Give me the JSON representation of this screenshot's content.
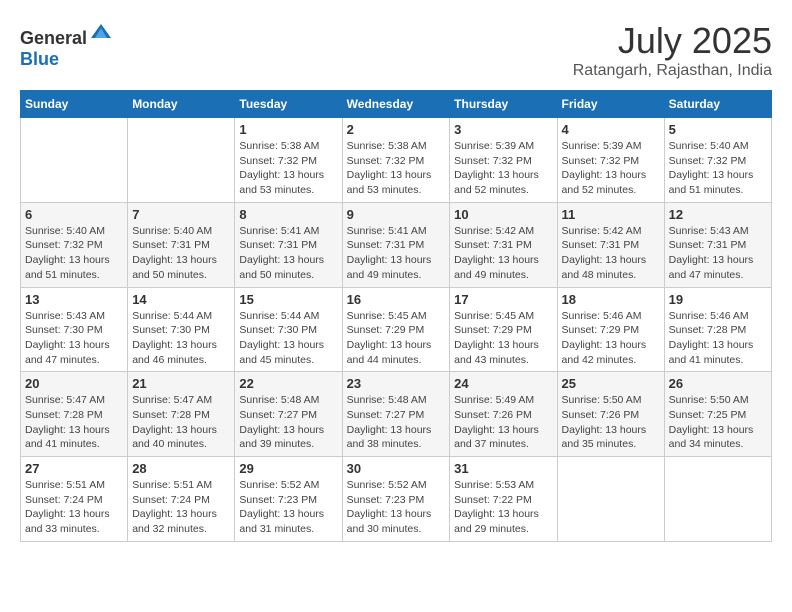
{
  "header": {
    "logo_general": "General",
    "logo_blue": "Blue",
    "month": "July 2025",
    "location": "Ratangarh, Rajasthan, India"
  },
  "weekdays": [
    "Sunday",
    "Monday",
    "Tuesday",
    "Wednesday",
    "Thursday",
    "Friday",
    "Saturday"
  ],
  "weeks": [
    [
      {
        "day": "",
        "sunrise": "",
        "sunset": "",
        "daylight": ""
      },
      {
        "day": "",
        "sunrise": "",
        "sunset": "",
        "daylight": ""
      },
      {
        "day": "1",
        "sunrise": "Sunrise: 5:38 AM",
        "sunset": "Sunset: 7:32 PM",
        "daylight": "Daylight: 13 hours and 53 minutes."
      },
      {
        "day": "2",
        "sunrise": "Sunrise: 5:38 AM",
        "sunset": "Sunset: 7:32 PM",
        "daylight": "Daylight: 13 hours and 53 minutes."
      },
      {
        "day": "3",
        "sunrise": "Sunrise: 5:39 AM",
        "sunset": "Sunset: 7:32 PM",
        "daylight": "Daylight: 13 hours and 52 minutes."
      },
      {
        "day": "4",
        "sunrise": "Sunrise: 5:39 AM",
        "sunset": "Sunset: 7:32 PM",
        "daylight": "Daylight: 13 hours and 52 minutes."
      },
      {
        "day": "5",
        "sunrise": "Sunrise: 5:40 AM",
        "sunset": "Sunset: 7:32 PM",
        "daylight": "Daylight: 13 hours and 51 minutes."
      }
    ],
    [
      {
        "day": "6",
        "sunrise": "Sunrise: 5:40 AM",
        "sunset": "Sunset: 7:32 PM",
        "daylight": "Daylight: 13 hours and 51 minutes."
      },
      {
        "day": "7",
        "sunrise": "Sunrise: 5:40 AM",
        "sunset": "Sunset: 7:31 PM",
        "daylight": "Daylight: 13 hours and 50 minutes."
      },
      {
        "day": "8",
        "sunrise": "Sunrise: 5:41 AM",
        "sunset": "Sunset: 7:31 PM",
        "daylight": "Daylight: 13 hours and 50 minutes."
      },
      {
        "day": "9",
        "sunrise": "Sunrise: 5:41 AM",
        "sunset": "Sunset: 7:31 PM",
        "daylight": "Daylight: 13 hours and 49 minutes."
      },
      {
        "day": "10",
        "sunrise": "Sunrise: 5:42 AM",
        "sunset": "Sunset: 7:31 PM",
        "daylight": "Daylight: 13 hours and 49 minutes."
      },
      {
        "day": "11",
        "sunrise": "Sunrise: 5:42 AM",
        "sunset": "Sunset: 7:31 PM",
        "daylight": "Daylight: 13 hours and 48 minutes."
      },
      {
        "day": "12",
        "sunrise": "Sunrise: 5:43 AM",
        "sunset": "Sunset: 7:31 PM",
        "daylight": "Daylight: 13 hours and 47 minutes."
      }
    ],
    [
      {
        "day": "13",
        "sunrise": "Sunrise: 5:43 AM",
        "sunset": "Sunset: 7:30 PM",
        "daylight": "Daylight: 13 hours and 47 minutes."
      },
      {
        "day": "14",
        "sunrise": "Sunrise: 5:44 AM",
        "sunset": "Sunset: 7:30 PM",
        "daylight": "Daylight: 13 hours and 46 minutes."
      },
      {
        "day": "15",
        "sunrise": "Sunrise: 5:44 AM",
        "sunset": "Sunset: 7:30 PM",
        "daylight": "Daylight: 13 hours and 45 minutes."
      },
      {
        "day": "16",
        "sunrise": "Sunrise: 5:45 AM",
        "sunset": "Sunset: 7:29 PM",
        "daylight": "Daylight: 13 hours and 44 minutes."
      },
      {
        "day": "17",
        "sunrise": "Sunrise: 5:45 AM",
        "sunset": "Sunset: 7:29 PM",
        "daylight": "Daylight: 13 hours and 43 minutes."
      },
      {
        "day": "18",
        "sunrise": "Sunrise: 5:46 AM",
        "sunset": "Sunset: 7:29 PM",
        "daylight": "Daylight: 13 hours and 42 minutes."
      },
      {
        "day": "19",
        "sunrise": "Sunrise: 5:46 AM",
        "sunset": "Sunset: 7:28 PM",
        "daylight": "Daylight: 13 hours and 41 minutes."
      }
    ],
    [
      {
        "day": "20",
        "sunrise": "Sunrise: 5:47 AM",
        "sunset": "Sunset: 7:28 PM",
        "daylight": "Daylight: 13 hours and 41 minutes."
      },
      {
        "day": "21",
        "sunrise": "Sunrise: 5:47 AM",
        "sunset": "Sunset: 7:28 PM",
        "daylight": "Daylight: 13 hours and 40 minutes."
      },
      {
        "day": "22",
        "sunrise": "Sunrise: 5:48 AM",
        "sunset": "Sunset: 7:27 PM",
        "daylight": "Daylight: 13 hours and 39 minutes."
      },
      {
        "day": "23",
        "sunrise": "Sunrise: 5:48 AM",
        "sunset": "Sunset: 7:27 PM",
        "daylight": "Daylight: 13 hours and 38 minutes."
      },
      {
        "day": "24",
        "sunrise": "Sunrise: 5:49 AM",
        "sunset": "Sunset: 7:26 PM",
        "daylight": "Daylight: 13 hours and 37 minutes."
      },
      {
        "day": "25",
        "sunrise": "Sunrise: 5:50 AM",
        "sunset": "Sunset: 7:26 PM",
        "daylight": "Daylight: 13 hours and 35 minutes."
      },
      {
        "day": "26",
        "sunrise": "Sunrise: 5:50 AM",
        "sunset": "Sunset: 7:25 PM",
        "daylight": "Daylight: 13 hours and 34 minutes."
      }
    ],
    [
      {
        "day": "27",
        "sunrise": "Sunrise: 5:51 AM",
        "sunset": "Sunset: 7:24 PM",
        "daylight": "Daylight: 13 hours and 33 minutes."
      },
      {
        "day": "28",
        "sunrise": "Sunrise: 5:51 AM",
        "sunset": "Sunset: 7:24 PM",
        "daylight": "Daylight: 13 hours and 32 minutes."
      },
      {
        "day": "29",
        "sunrise": "Sunrise: 5:52 AM",
        "sunset": "Sunset: 7:23 PM",
        "daylight": "Daylight: 13 hours and 31 minutes."
      },
      {
        "day": "30",
        "sunrise": "Sunrise: 5:52 AM",
        "sunset": "Sunset: 7:23 PM",
        "daylight": "Daylight: 13 hours and 30 minutes."
      },
      {
        "day": "31",
        "sunrise": "Sunrise: 5:53 AM",
        "sunset": "Sunset: 7:22 PM",
        "daylight": "Daylight: 13 hours and 29 minutes."
      },
      {
        "day": "",
        "sunrise": "",
        "sunset": "",
        "daylight": ""
      },
      {
        "day": "",
        "sunrise": "",
        "sunset": "",
        "daylight": ""
      }
    ]
  ]
}
